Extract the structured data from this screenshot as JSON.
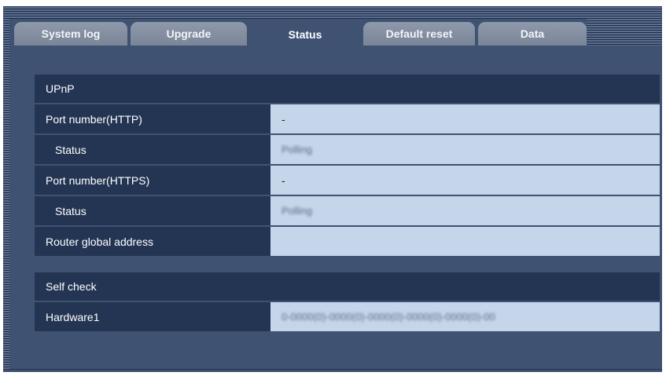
{
  "tabs": [
    {
      "label": "System log"
    },
    {
      "label": "Upgrade"
    },
    {
      "label": "Status",
      "active": true
    },
    {
      "label": "Default reset"
    },
    {
      "label": "Data"
    }
  ],
  "upnp": {
    "header": "UPnP",
    "rows": [
      {
        "label": "Port number(HTTP)",
        "value": "-"
      },
      {
        "label": "Status",
        "value": "Polling"
      },
      {
        "label": "Port number(HTTPS)",
        "value": "-"
      },
      {
        "label": "Status",
        "value": "Polling"
      },
      {
        "label": "Router global address",
        "value": ""
      }
    ]
  },
  "self_check": {
    "header": "Self check",
    "rows": [
      {
        "label": "Hardware1",
        "value": "0-0000(0)-0000(0)-0000(0)-0000(0)-0000(0)-00"
      }
    ]
  },
  "colors": {
    "background": "#3f5272",
    "label_bg": "#243553",
    "value_bg": "#c5d5ea",
    "tab_inactive": "#8e99ab"
  }
}
